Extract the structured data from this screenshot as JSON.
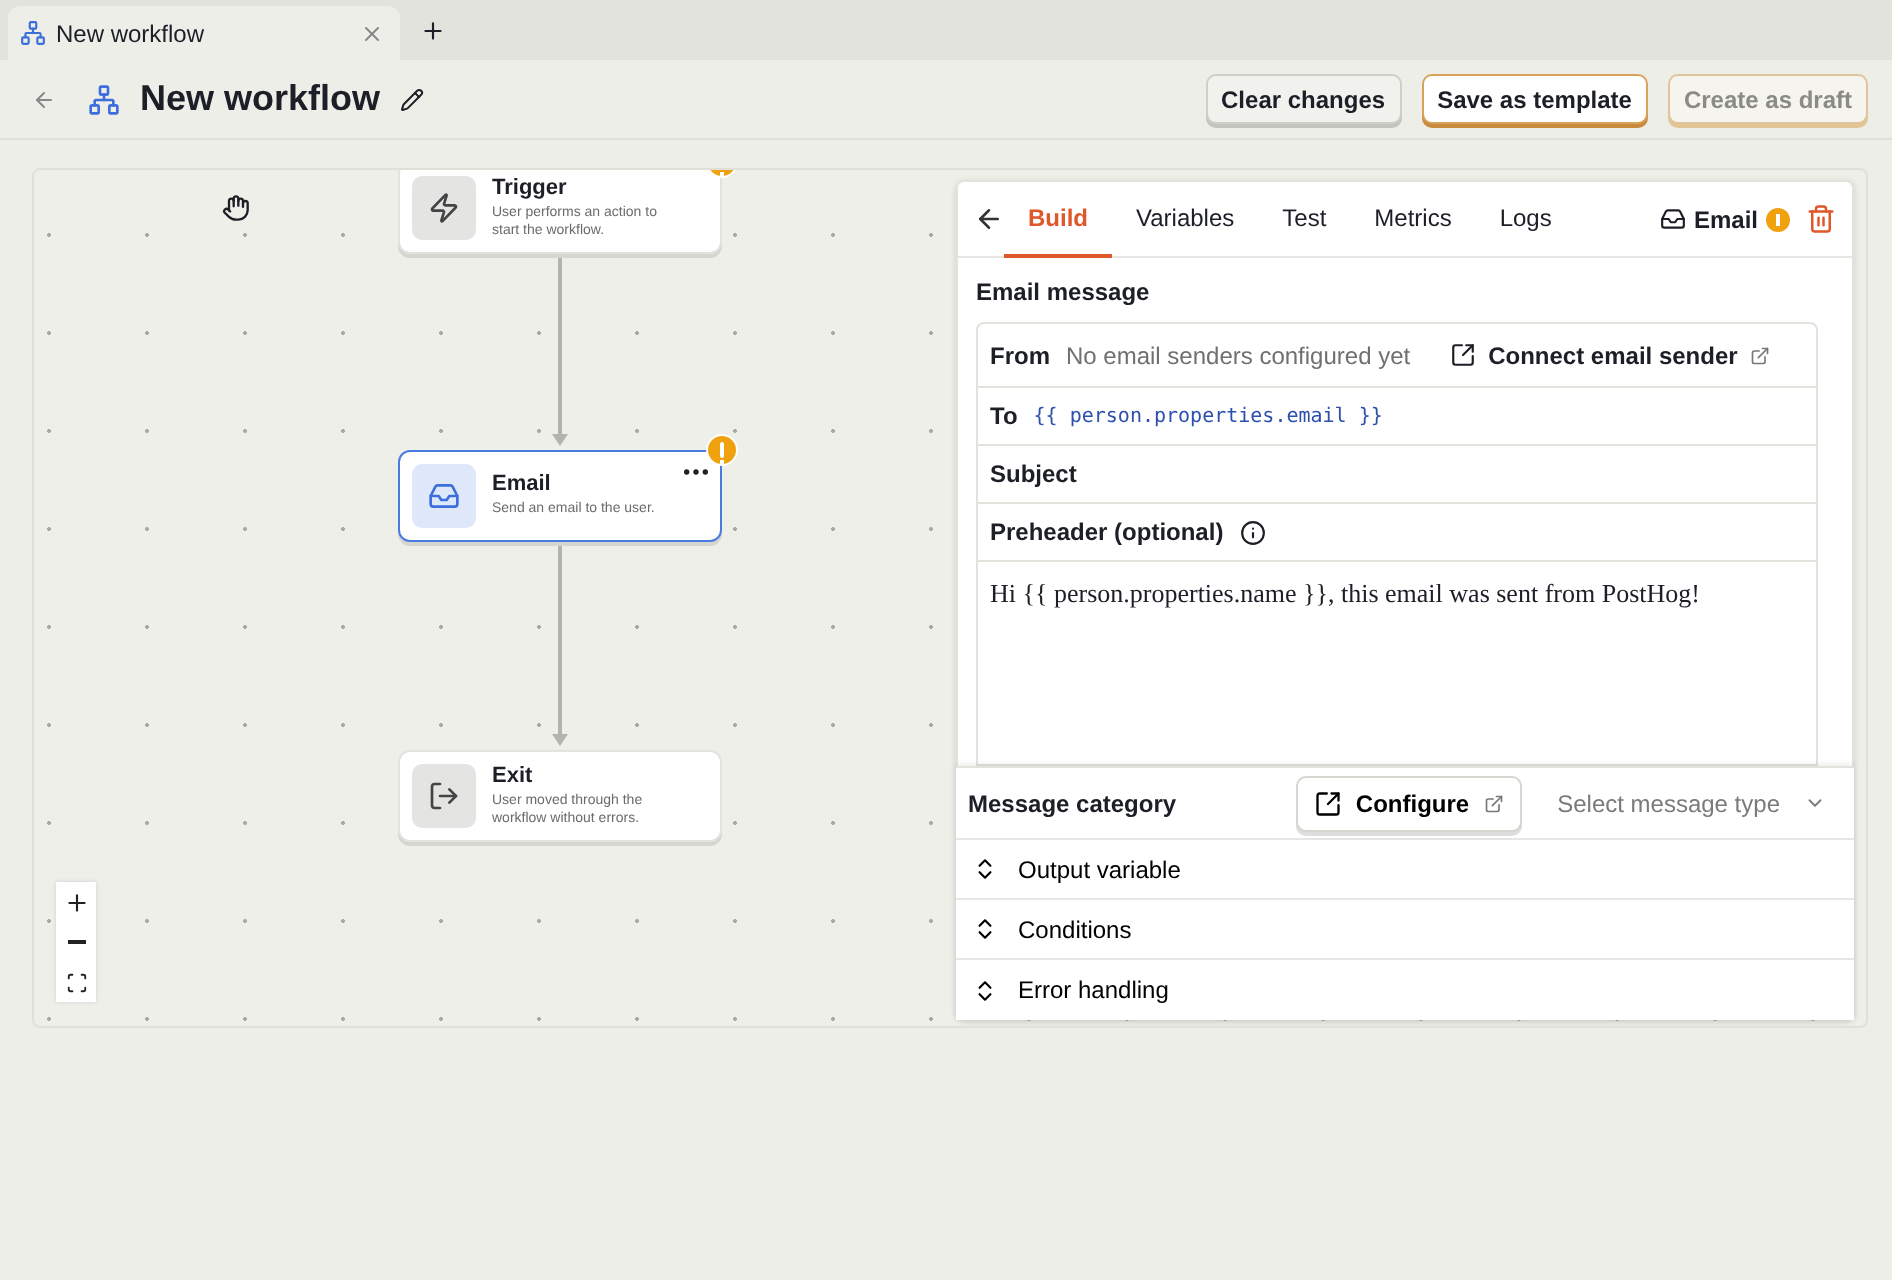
{
  "browser_tab": {
    "title": "New workflow"
  },
  "header": {
    "title": "New workflow",
    "buttons": [
      {
        "label": "Clear changes",
        "kind": "default"
      },
      {
        "label": "Save as template",
        "kind": "accent"
      },
      {
        "label": "Create as draft",
        "kind": "muted"
      }
    ]
  },
  "canvas": {
    "nodes": [
      {
        "kind": "trigger",
        "title": "Trigger",
        "description": "User performs an action to start the workflow.",
        "selected": false,
        "warning": true
      },
      {
        "kind": "email",
        "title": "Email",
        "description": "Send an email to the user.",
        "selected": true,
        "warning": true
      },
      {
        "kind": "exit",
        "title": "Exit",
        "description": "User moved through the workflow without errors.",
        "selected": false,
        "warning": false
      }
    ]
  },
  "panel": {
    "tabs": [
      {
        "label": "Build",
        "selected": true
      },
      {
        "label": "Variables",
        "selected": false
      },
      {
        "label": "Test",
        "selected": false
      },
      {
        "label": "Metrics",
        "selected": false
      },
      {
        "label": "Logs",
        "selected": false
      }
    ],
    "step": {
      "label": "Email",
      "warning": true
    },
    "section_title": "Email message",
    "from": {
      "label": "From",
      "value": "No email senders configured yet",
      "link": "Connect email sender"
    },
    "fields": [
      {
        "label": "To",
        "value": "{{ person.properties.email }}",
        "info": false
      },
      {
        "label": "Subject",
        "info": false
      },
      {
        "label": "**Preheader** (optional)",
        "info": true
      }
    ],
    "body": "Hi {{ person.properties.name }}, this email was sent from PostHog!",
    "category": {
      "label": "Message category",
      "button": "Configure",
      "placeholder": "Select message type"
    },
    "sections": [
      {
        "label": "Output variable",
        "expanded": false
      },
      {
        "label": "Conditions",
        "expanded": false
      },
      {
        "label": "Error handling",
        "expanded": false
      }
    ]
  }
}
